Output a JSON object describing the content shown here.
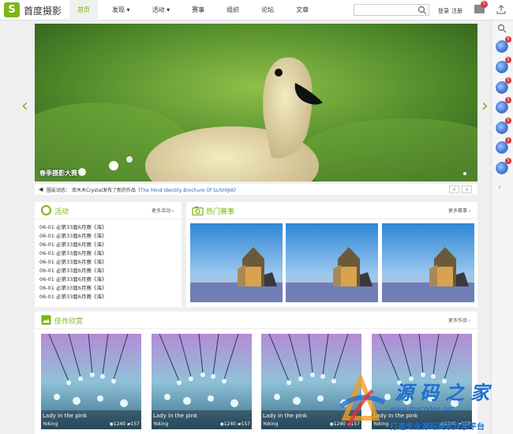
{
  "header": {
    "logo_mark": "S",
    "site_name": "首度摄影",
    "nav": [
      {
        "label": "首页"
      },
      {
        "label": "发现"
      },
      {
        "label": "活动"
      },
      {
        "label": "赛事"
      },
      {
        "label": "组织"
      },
      {
        "label": "论坛"
      },
      {
        "label": "文章"
      }
    ],
    "login": "登录",
    "register": "注册",
    "mail_count": "5"
  },
  "sidebar": {
    "badges": [
      "5",
      "5",
      "5",
      "5",
      "5",
      "5",
      "5"
    ]
  },
  "banner": {
    "caption": "春季摄影大赛"
  },
  "ticker": {
    "prefix": "圈友动态：",
    "user_text": "南木木Crystal发布了新的作品",
    "work_title": "《The Mind Identity Brochure Of SUSHIJIA》"
  },
  "activity": {
    "title": "活动",
    "more": "更多活动",
    "items": [
      "06-01 必第33届6月赛《海》",
      "06-01 必第33届6月赛《海》",
      "06-01 必第33届6月赛《海》",
      "06-01 必第33届6月赛《海》",
      "06-01 必第33届6月赛《海》",
      "06-01 必第33届6月赛《海》",
      "06-01 必第33届6月赛《海》",
      "06-01 必第33届6月赛《海》",
      "06-01 必第33届6月赛《海》"
    ]
  },
  "contest": {
    "title": "热门赛事",
    "more": "更多赛事"
  },
  "gallery": {
    "title": "佳作欣赏",
    "more": "更多作品",
    "cards": [
      {
        "title": "Lady in the pink",
        "author": "Yoking",
        "views": "1240",
        "comments": "157"
      },
      {
        "title": "Lady in the pink",
        "author": "Yoking",
        "views": "1240",
        "comments": "157"
      },
      {
        "title": "Lady in the pink",
        "author": "Yoking",
        "views": "1240",
        "comments": "157"
      },
      {
        "title": "Lady in the pink",
        "author": "Yoking",
        "views": "1240",
        "comments": "157"
      }
    ]
  },
  "watermark": {
    "brand": "源码之家",
    "url": "www.mycodes.net",
    "slogan": "打造专业源码商家共享平台"
  }
}
